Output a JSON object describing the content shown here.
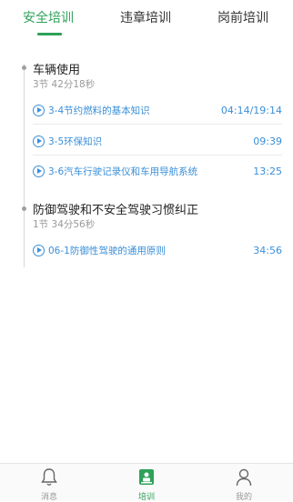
{
  "tabs": [
    {
      "label": "安全培训",
      "active": true
    },
    {
      "label": "违章培训",
      "active": false
    },
    {
      "label": "岗前培训",
      "active": false
    }
  ],
  "sections": [
    {
      "title": "车辆使用",
      "meta": "3节   42分18秒",
      "lessons": [
        {
          "title": "3-4节约燃料的基本知识",
          "time": "04:14/19:14"
        },
        {
          "title": "3-5环保知识",
          "time": "09:39"
        },
        {
          "title": "3-6汽车行驶记录仪和车用导航系统",
          "time": "13:25"
        }
      ]
    },
    {
      "title": "防御驾驶和不安全驾驶习惯纠正",
      "meta": "1节   34分56秒",
      "lessons": [
        {
          "title": "06-1防御性驾驶的通用原则",
          "time": "34:56"
        }
      ]
    }
  ],
  "bottom_nav": [
    {
      "label": "消息",
      "icon": "bell-icon",
      "active": false
    },
    {
      "label": "培训",
      "icon": "training-icon",
      "active": true
    },
    {
      "label": "我的",
      "icon": "user-icon",
      "active": false
    }
  ],
  "colors": {
    "accent": "#2fa15a",
    "link": "#3a8fd8"
  }
}
